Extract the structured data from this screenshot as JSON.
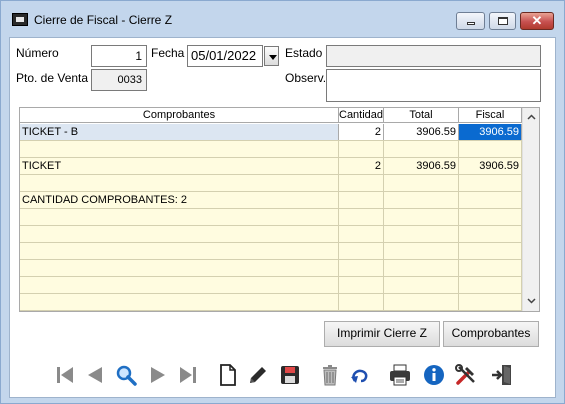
{
  "window": {
    "title": "Cierre de Fiscal - Cierre Z",
    "close_glyph": "✕",
    "icons": {
      "app": "calculator-icon",
      "minimize": "minimize-icon",
      "maximize": "maximize-icon",
      "close": "close-icon"
    }
  },
  "form": {
    "numero_label": "Número",
    "numero_value": "1",
    "fecha_label": "Fecha",
    "fecha_value": "05/01/2022",
    "estado_label": "Estado",
    "estado_value": "",
    "pto_venta_label": "Pto. de Venta",
    "pto_venta_value": "0033",
    "observ_label": "Observ.",
    "observ_value": ""
  },
  "table": {
    "columns": [
      "Comprobantes",
      "Cantidad",
      "Total",
      "Fiscal"
    ],
    "rows": [
      {
        "comprobante": "TICKET - B",
        "cantidad": "2",
        "total": "3906.59",
        "fiscal": "3906.59"
      },
      {
        "comprobante": "",
        "cantidad": "",
        "total": "",
        "fiscal": ""
      },
      {
        "comprobante": "TICKET",
        "cantidad": "2",
        "total": "3906.59",
        "fiscal": "3906.59"
      },
      {
        "comprobante": "",
        "cantidad": "",
        "total": "",
        "fiscal": ""
      },
      {
        "comprobante": "CANTIDAD COMPROBANTES: 2",
        "cantidad": "",
        "total": "",
        "fiscal": ""
      },
      {
        "comprobante": "",
        "cantidad": "",
        "total": "",
        "fiscal": ""
      },
      {
        "comprobante": "",
        "cantidad": "",
        "total": "",
        "fiscal": ""
      },
      {
        "comprobante": "",
        "cantidad": "",
        "total": "",
        "fiscal": ""
      },
      {
        "comprobante": "",
        "cantidad": "",
        "total": "",
        "fiscal": ""
      },
      {
        "comprobante": "",
        "cantidad": "",
        "total": "",
        "fiscal": ""
      },
      {
        "comprobante": "",
        "cantidad": "",
        "total": "",
        "fiscal": ""
      }
    ],
    "selected_row": 0
  },
  "buttons": {
    "imprimir": "Imprimir Cierre Z",
    "comprobantes": "Comprobantes"
  },
  "toolbar": {
    "icons": [
      "first-record-icon",
      "previous-record-icon",
      "search-icon",
      "next-record-icon",
      "last-record-icon",
      "new-document-icon",
      "edit-pencil-icon",
      "save-disk-icon",
      "delete-trash-icon",
      "undo-icon",
      "print-icon",
      "info-icon",
      "tools-icon",
      "exit-door-icon"
    ]
  }
}
